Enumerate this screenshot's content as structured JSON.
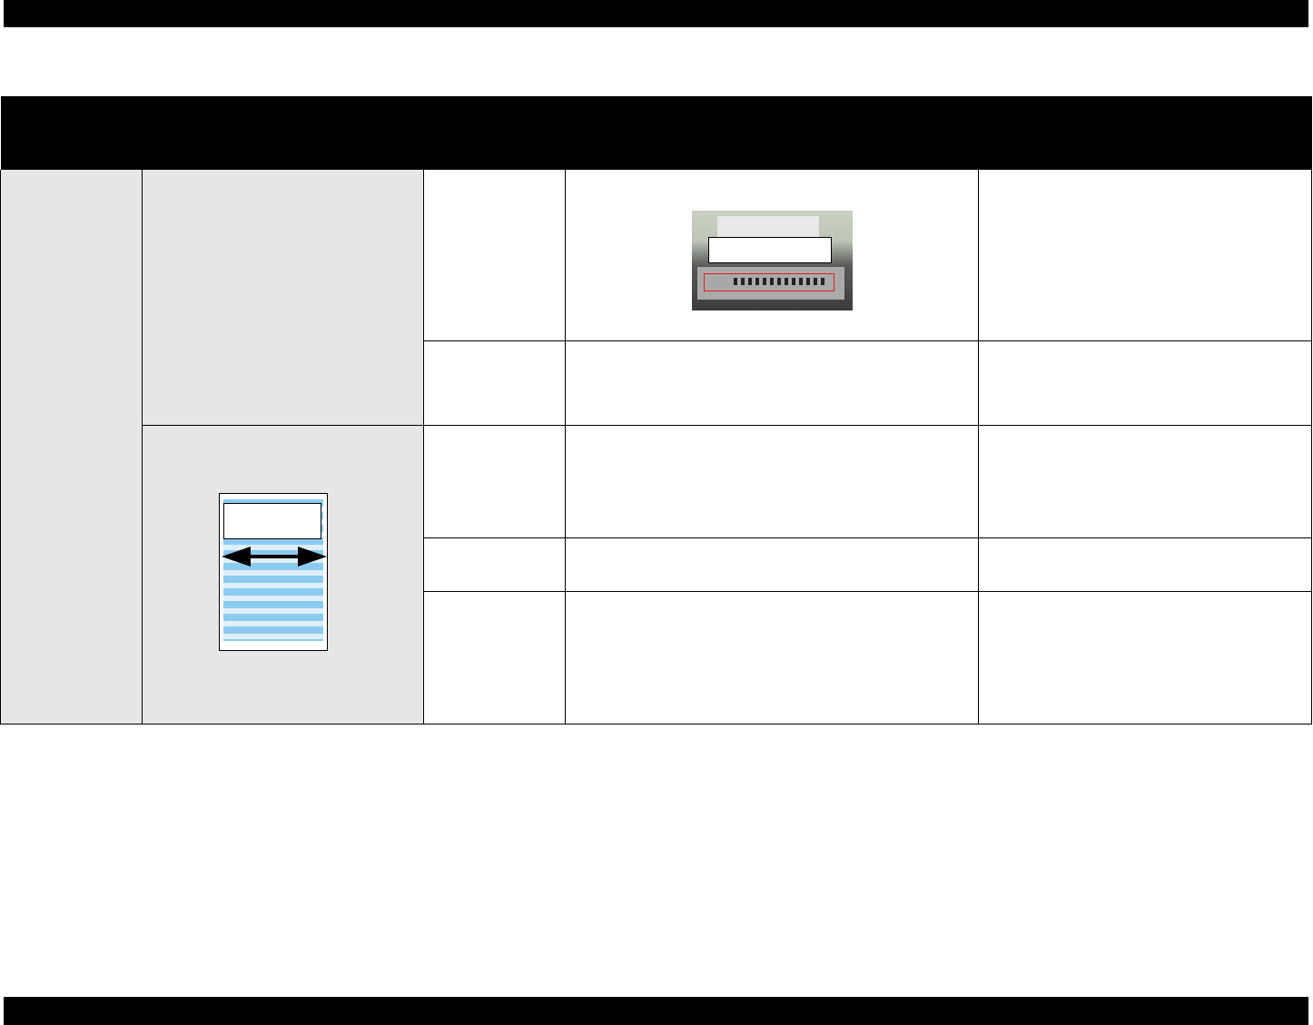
{
  "document": {
    "header_text": "",
    "footer_text": "",
    "table_head_text": ""
  },
  "figures": {
    "printer_photo": {
      "label": "",
      "icon": "printer-photo"
    },
    "page_diagram": {
      "label": "",
      "icon": "page-stripes-diagram"
    }
  },
  "colors": {
    "band": "#000000",
    "grey_cell": "#e6e6e6",
    "highlight": "#e02020",
    "stripe": "#8ccbf0"
  }
}
